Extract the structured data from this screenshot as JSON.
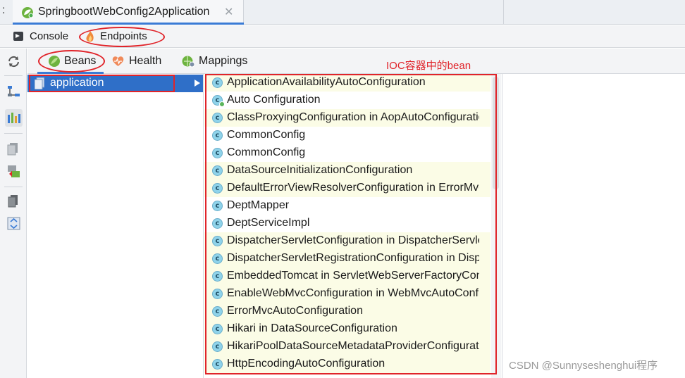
{
  "title_tab": {
    "prefix": ":",
    "label": "SpringbootWebConfig2Application",
    "close": "✕"
  },
  "toolbar": {
    "console_label": "Console",
    "endpoints_label": "Endpoints"
  },
  "subtabs": {
    "beans": "Beans",
    "health": "Health",
    "mappings": "Mappings"
  },
  "annotation": "IOC容器中的bean",
  "tree": {
    "selected": "application"
  },
  "bean_icon_letter": "c",
  "beans": [
    {
      "name": "ApplicationAvailabilityAutoConfiguration",
      "highlight": true
    },
    {
      "name": "Auto Configuration",
      "highlight": false,
      "badge": true
    },
    {
      "name": "ClassProxyingConfiguration in AopAutoConfiguration",
      "highlight": true
    },
    {
      "name": "CommonConfig",
      "highlight": false
    },
    {
      "name": "CommonConfig",
      "highlight": false
    },
    {
      "name": "DataSourceInitializationConfiguration",
      "highlight": true
    },
    {
      "name": "DefaultErrorViewResolverConfiguration in ErrorMvcAutoConfiguration",
      "highlight": true
    },
    {
      "name": "DeptMapper",
      "highlight": false
    },
    {
      "name": "DeptServiceImpl",
      "highlight": false
    },
    {
      "name": "DispatcherServletConfiguration in DispatcherServletAutoConfiguration",
      "highlight": true
    },
    {
      "name": "DispatcherServletRegistrationConfiguration in DispatcherServletAutoConfiguration",
      "highlight": true
    },
    {
      "name": "EmbeddedTomcat in ServletWebServerFactoryConfiguration",
      "highlight": true
    },
    {
      "name": "EnableWebMvcConfiguration in WebMvcAutoConfiguration",
      "highlight": true
    },
    {
      "name": "ErrorMvcAutoConfiguration",
      "highlight": true
    },
    {
      "name": "Hikari in DataSourceConfiguration",
      "highlight": true
    },
    {
      "name": "HikariPoolDataSourceMetadataProviderConfiguration",
      "highlight": true
    },
    {
      "name": "HttpEncodingAutoConfiguration",
      "highlight": true
    }
  ],
  "watermark": "CSDN @Sunnyseshenghui程序",
  "colors": {
    "accent": "#3a7bd5",
    "selection": "#2f6fc8",
    "annotation": "#e0242a",
    "bean_highlight": "#fbfce6",
    "bean_icon": "#8fd3ea"
  }
}
